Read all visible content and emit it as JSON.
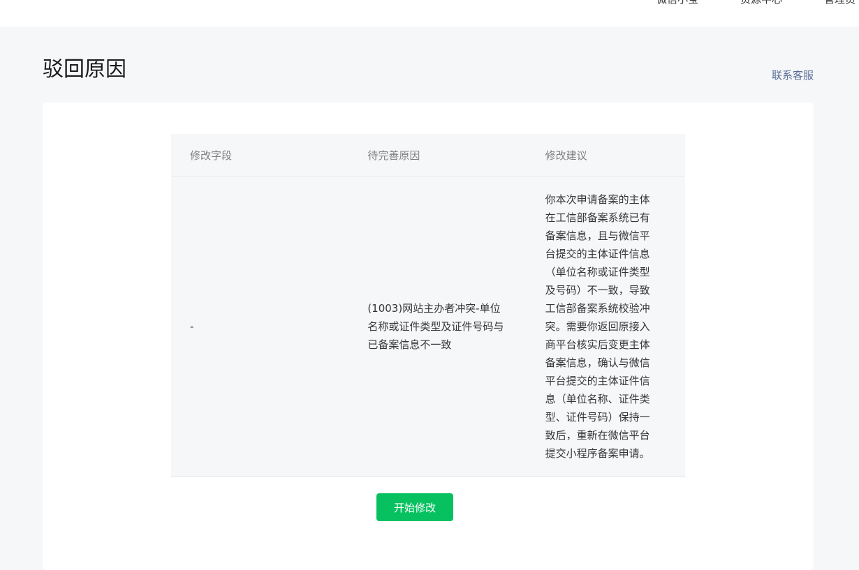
{
  "topnav": {
    "items": [
      "微信小宝",
      "资源中心",
      "管理员"
    ]
  },
  "header": {
    "title": "驳回原因",
    "contact_label": "联系客服"
  },
  "table": {
    "columns": [
      "修改字段",
      "待完善原因",
      "修改建议"
    ],
    "rows": [
      {
        "field": "-",
        "reason": "(1003)网站主办者冲突-单位名称或证件类型及证件号码与已备案信息不一致",
        "suggestion": "你本次申请备案的主体在工信部备案系统已有备案信息，且与微信平台提交的主体证件信息（单位名称或证件类型及号码）不一致，导致工信部备案系统校验冲突。需要你返回原接入商平台核实后变更主体备案信息，确认与微信平台提交的主体证件信息（单位名称、证件类型、证件号码）保持一致后，重新在微信平台提交小程序备案申请。"
      }
    ]
  },
  "actions": {
    "start_label": "开始修改"
  },
  "colors": {
    "primary": "#07c160",
    "link": "#576b95",
    "background": "#f6f7f9"
  }
}
